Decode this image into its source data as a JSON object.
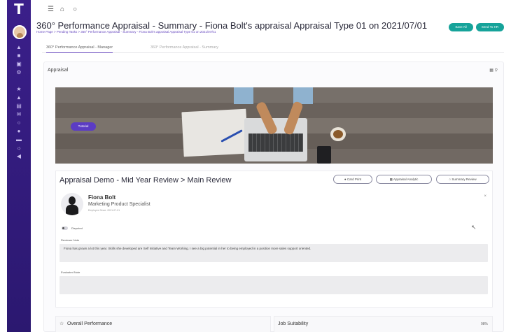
{
  "app": {
    "logo": "T",
    "sidebar_icons": [
      "home-icon",
      "grid-icon",
      "calendar-icon",
      "settings-icon",
      "trophy-icon",
      "chart-icon",
      "document-icon",
      "mail-icon",
      "search-icon",
      "user-icon",
      "briefcase-icon",
      "cog-icon",
      "arrow-left-icon"
    ]
  },
  "topbar": {
    "icons": [
      "menu-icon",
      "home-icon",
      "bell-icon"
    ]
  },
  "header": {
    "title": "360° Performance Appraisal - Summary - Fiona Bolt's appraisal Appraisal Type 01 on 2021/07/01",
    "breadcrumb": "Home Page > Pending Tasks > 360° Performance Appraisal - Summary - Fiona Bolt's appraisal Appraisal Type 01 on 2021/07/01",
    "save_all_label": "Save All",
    "send_label": "Send To HR"
  },
  "tabs": [
    {
      "label": "360° Performance Appraisal - Manager",
      "active": true
    },
    {
      "label": "360° Performance Appraisal - Summary",
      "active": false
    }
  ],
  "panel": {
    "title": "Appraisal"
  },
  "banner": {
    "tutorial_label": "Tutorial"
  },
  "review": {
    "title": "Appraisal Demo - Mid Year Review > Main Review",
    "buttons": {
      "card_print": "Card Print",
      "appraisal_analytic": "Appraisal Analytic",
      "summary_review": "Summary Review"
    },
    "person": {
      "name": "Fiona Bolt",
      "role": "Marketing Product Specialist",
      "date": "Employee Since: 2021-07-01"
    },
    "disputed_label": "Disputed",
    "reviewer_note_label": "Reviewer Note",
    "reviewer_note": "Fiona has grown a lot this year. Skills she developed are Self Initiative and Team Working. I see a big potential in her to being employed in a position more sales support oriented.",
    "evaluated_note_label": "Evaluated Note",
    "evaluated_note": ""
  },
  "bottom": {
    "overall_performance": "Overall Performance",
    "job_suitability": "Job Suitability",
    "job_suitability_value": "98%"
  },
  "colors": {
    "sidebar": "#3b1f8a",
    "accent_green": "#16a39a",
    "accent_purple": "#5b3cc4"
  }
}
